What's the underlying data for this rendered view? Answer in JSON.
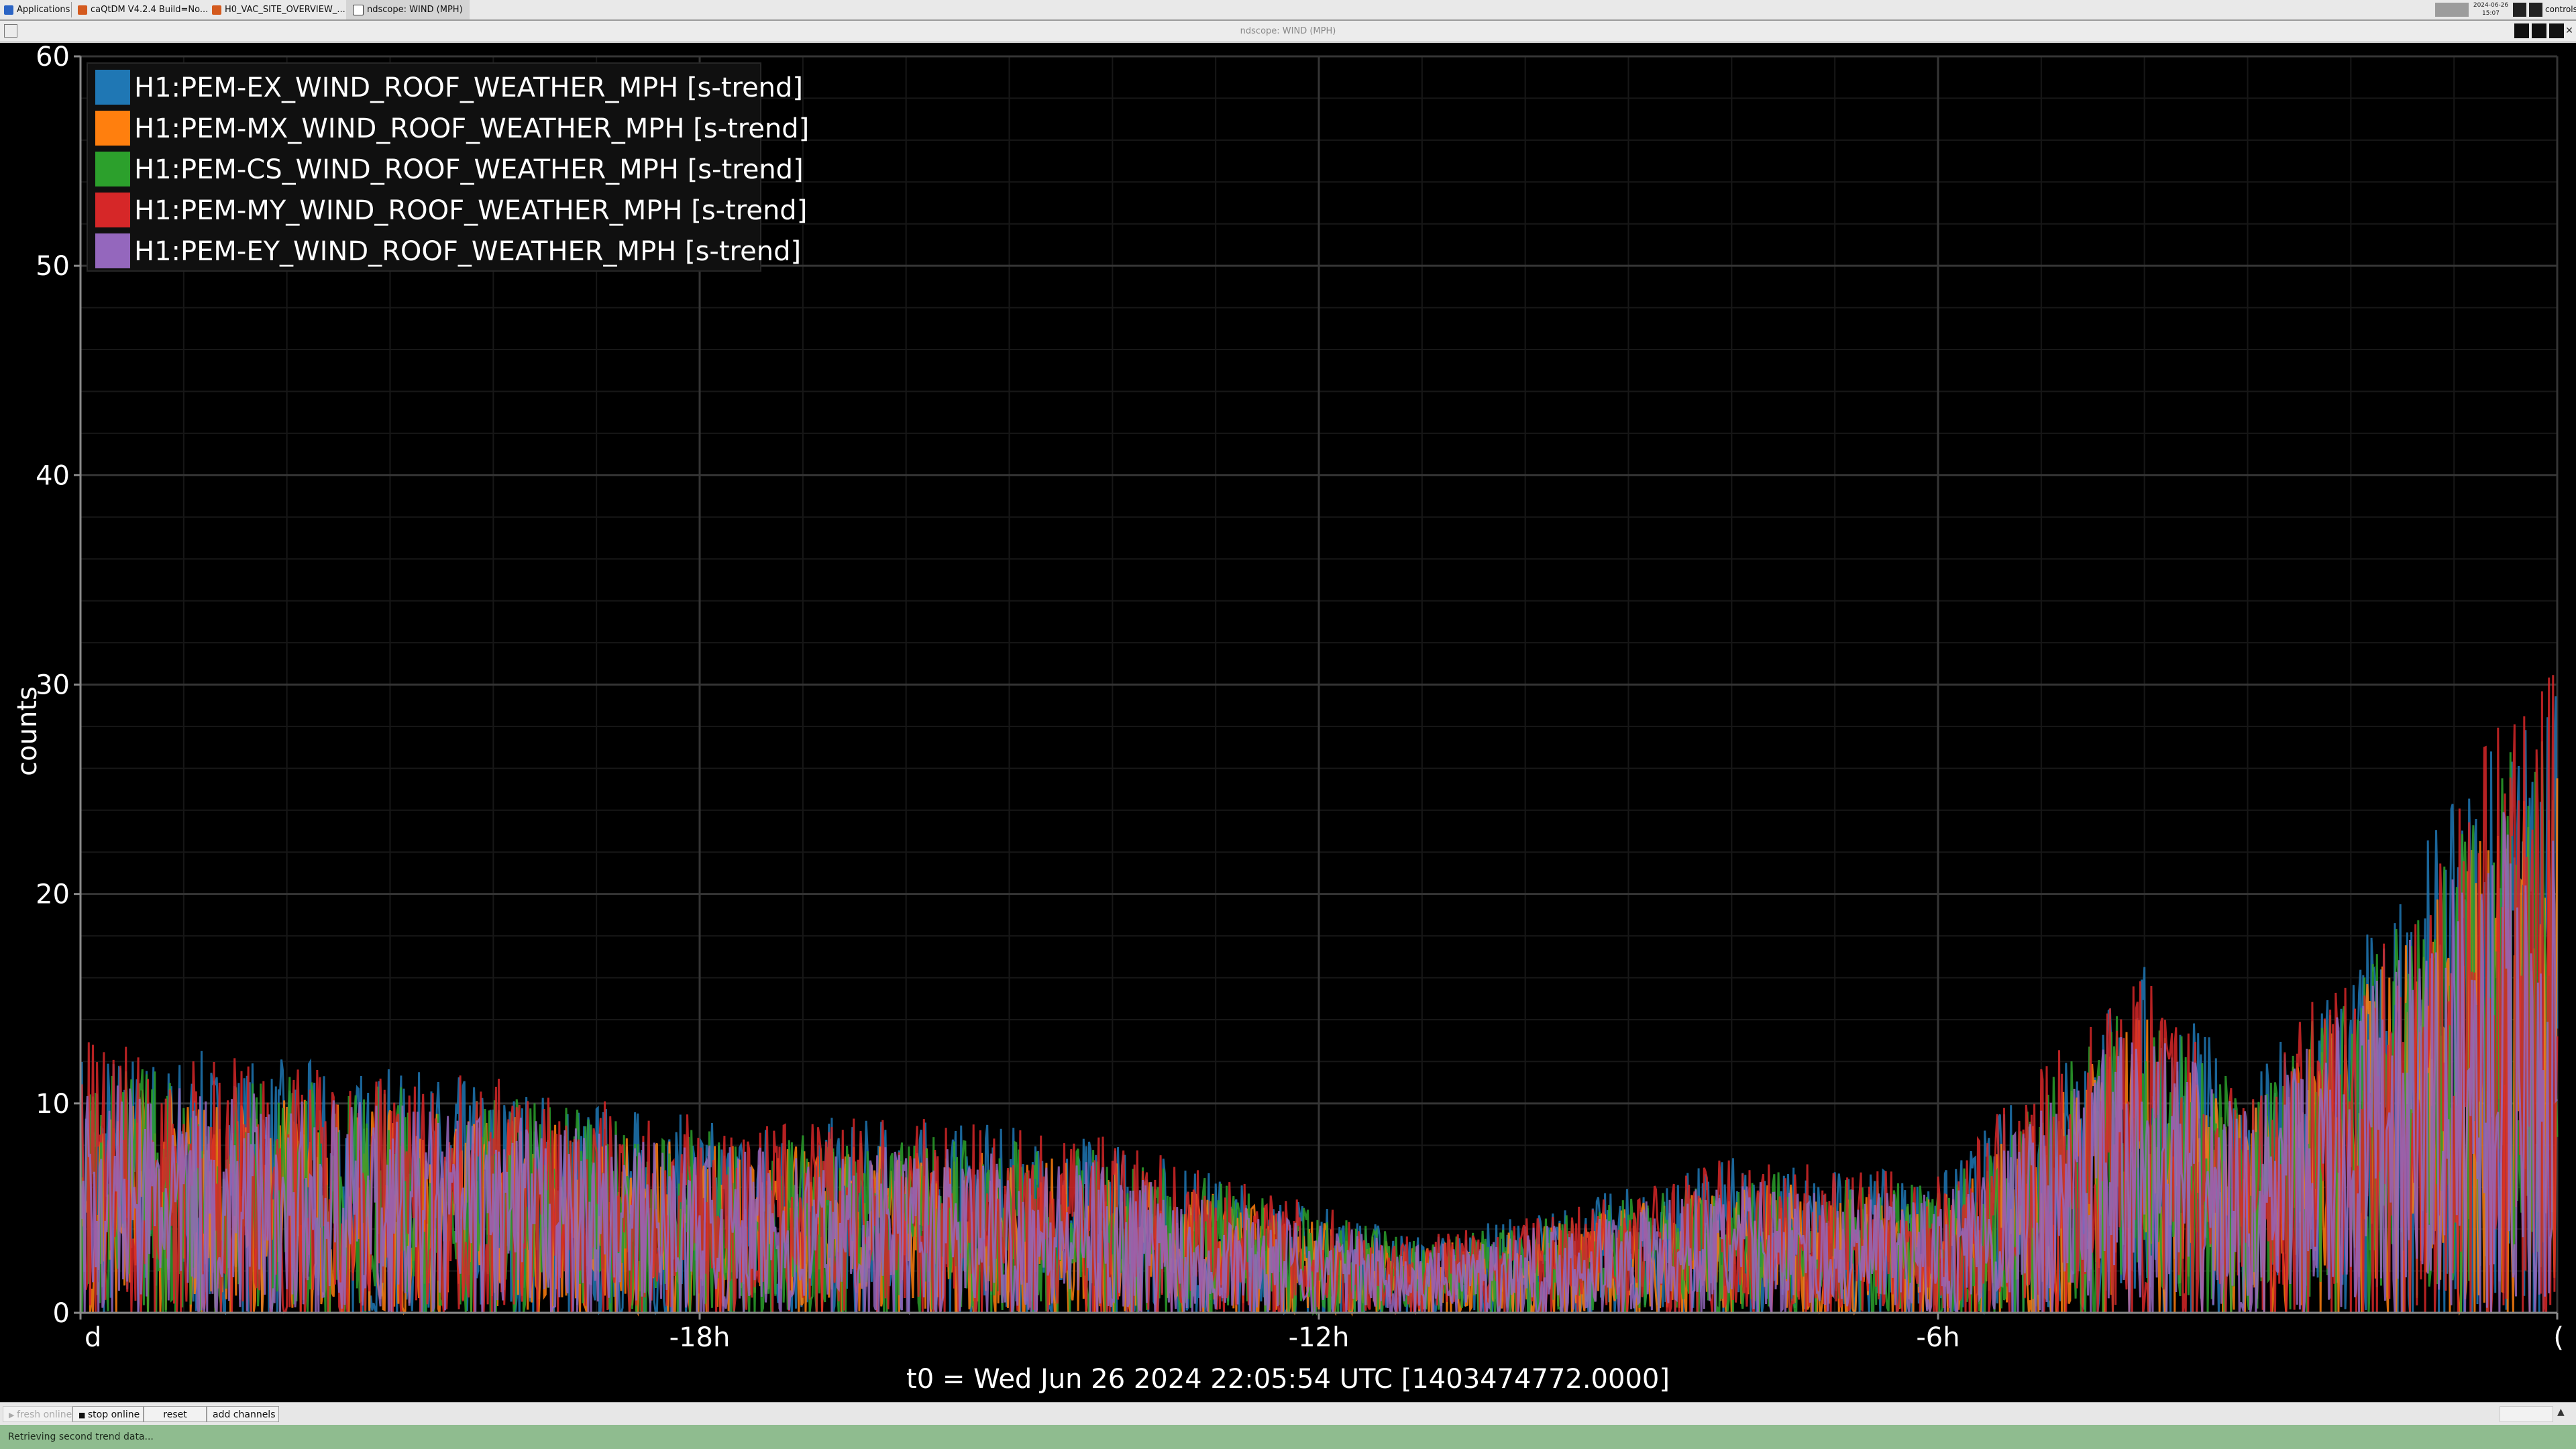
{
  "taskbar": {
    "items": [
      {
        "label": "Applications",
        "icon": "apps-icon",
        "color": "#2b64c4"
      },
      {
        "label": "caQtDM V4.2.4 Build=No...",
        "icon": "caqtdm-icon",
        "color": "#d45a1e"
      },
      {
        "label": "H0_VAC_SITE_OVERVIEW_...",
        "icon": "caqtdm-icon",
        "color": "#d45a1e"
      },
      {
        "label": "ndscope: WIND (MPH)",
        "icon": "ndscope-icon",
        "color": "#3a3a3a"
      }
    ],
    "clock": {
      "date": "2024-06-26",
      "time": "15:07"
    },
    "tray_label": "controls"
  },
  "window": {
    "title": "ndscope: WIND (MPH)"
  },
  "plot": {
    "ylabel": "counts",
    "x_caption": "t0 = Wed Jun 26 2024 22:05:54 UTC [1403474772.0000]",
    "y_ticks": [
      "0",
      "10",
      "20",
      "30",
      "40",
      "50",
      "60"
    ],
    "x_ticks": [
      "d",
      "-18h",
      "-12h",
      "-6h",
      "("
    ]
  },
  "chart_data": {
    "type": "line",
    "ylabel": "counts",
    "ylim": [
      0,
      60
    ],
    "xlim_hours": [
      -24,
      0
    ],
    "x_tick_labels": [
      "d",
      "-18h",
      "-12h",
      "-6h",
      "("
    ],
    "grid": true,
    "legend_placement": "top-left",
    "series": [
      {
        "name": "H1:PEM-EX_WIND_ROOF_WEATHER_MPH [s-trend]",
        "color": "#1f77b4"
      },
      {
        "name": "H1:PEM-MX_WIND_ROOF_WEATHER_MPH [s-trend]",
        "color": "#ff7f0e"
      },
      {
        "name": "H1:PEM-CS_WIND_ROOF_WEATHER_MPH [s-trend]",
        "color": "#2ca02c"
      },
      {
        "name": "H1:PEM-MY_WIND_ROOF_WEATHER_MPH [s-trend]",
        "color": "#d62728"
      },
      {
        "name": "H1:PEM-EY_WIND_ROOF_WEATHER_MPH [s-trend]",
        "color": "#9467bd"
      }
    ],
    "envelope_profile": [
      {
        "x": -24,
        "hi": 14,
        "lo": 0
      },
      {
        "x": -22,
        "hi": 13,
        "lo": 0
      },
      {
        "x": -20,
        "hi": 12,
        "lo": 0
      },
      {
        "x": -18,
        "hi": 10,
        "lo": 0
      },
      {
        "x": -16,
        "hi": 10,
        "lo": 0
      },
      {
        "x": -14,
        "hi": 9,
        "lo": 0
      },
      {
        "x": -12.3,
        "hi": 6,
        "lo": 0
      },
      {
        "x": -11,
        "hi": 4,
        "lo": 0
      },
      {
        "x": -10,
        "hi": 5,
        "lo": 0
      },
      {
        "x": -8,
        "hi": 8,
        "lo": 0
      },
      {
        "x": -6,
        "hi": 7,
        "lo": 0
      },
      {
        "x": -4,
        "hi": 18,
        "lo": 0
      },
      {
        "x": -3,
        "hi": 12,
        "lo": 0
      },
      {
        "x": -1.5,
        "hi": 22,
        "lo": 0
      },
      {
        "x": -0.5,
        "hi": 31,
        "lo": 0
      },
      {
        "x": 0,
        "hi": 33,
        "lo": 0
      }
    ]
  },
  "toolbar": {
    "buttons": [
      {
        "label": "fresh online",
        "enabled": false
      },
      {
        "label": "stop online",
        "enabled": true
      },
      {
        "label": "reset",
        "enabled": true
      },
      {
        "label": "add channels",
        "enabled": true
      }
    ],
    "right_label": ""
  },
  "status": {
    "text": "Retrieving second trend data..."
  }
}
